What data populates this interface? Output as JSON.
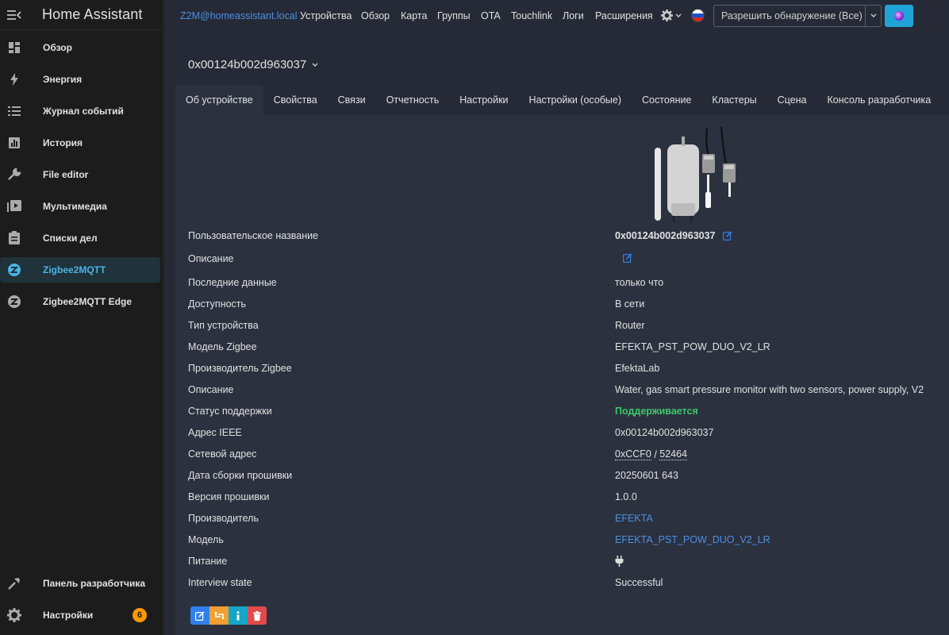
{
  "sidebar": {
    "title": "Home Assistant",
    "items": [
      {
        "label": "Обзор",
        "icon": "dashboard-icon"
      },
      {
        "label": "Энергия",
        "icon": "lightning-icon"
      },
      {
        "label": "Журнал событий",
        "icon": "list-icon"
      },
      {
        "label": "История",
        "icon": "chart-icon"
      },
      {
        "label": "File editor",
        "icon": "wrench-icon"
      },
      {
        "label": "Мультимедиа",
        "icon": "media-icon"
      },
      {
        "label": "Списки дел",
        "icon": "clipboard-icon"
      },
      {
        "label": "Zigbee2MQTT",
        "icon": "zigbee-icon"
      },
      {
        "label": "Zigbee2MQTT Edge",
        "icon": "zigbee-icon"
      }
    ],
    "bottom": [
      {
        "label": "Панель разработчика",
        "icon": "hammer-icon"
      },
      {
        "label": "Настройки",
        "icon": "gear-icon",
        "badge": "6"
      }
    ],
    "active_color": "#4bb4e6",
    "badge_color": "#ff9800"
  },
  "topnav": {
    "host": "Z2M@homeassistant.local",
    "links": [
      "Устройства",
      "Обзор",
      "Карта",
      "Группы",
      "OTA",
      "Touchlink",
      "Логи",
      "Расширения"
    ],
    "permit_join": "Разрешить обнаружение (Все)"
  },
  "device": {
    "title": "0x00124b002d963037",
    "tabs": [
      "Об устройстве",
      "Свойства",
      "Связи",
      "Отчетность",
      "Настройки",
      "Настройки (особые)",
      "Состояние",
      "Кластеры",
      "Сцена",
      "Консоль разработчика"
    ],
    "rows": [
      {
        "key": "Пользовательское название",
        "value": "0x00124b002d963037"
      },
      {
        "key": "Описание",
        "value": ""
      },
      {
        "key": "Последние данные",
        "value": "только что"
      },
      {
        "key": "Доступность",
        "value": "В сети"
      },
      {
        "key": "Тип устройства",
        "value": "Router"
      },
      {
        "key": "Модель Zigbee",
        "value": "EFEKTA_PST_POW_DUO_V2_LR"
      },
      {
        "key": "Производитель Zigbee",
        "value": "EfektaLab"
      },
      {
        "key": "Описание",
        "value": "Water, gas smart pressure monitor with two sensors, power supply, V2"
      },
      {
        "key": "Статус поддержки",
        "value": "Поддерживается"
      },
      {
        "key": "Адрес IEEE",
        "value": "0x00124b002d963037"
      },
      {
        "key": "Сетевой адрес",
        "value_hex": "0xCCF0",
        "value_sep": " / ",
        "value_dec": "52464"
      },
      {
        "key": "Дата сборки прошивки",
        "value": "20250601 643"
      },
      {
        "key": "Версия прошивки",
        "value": "1.0.0"
      },
      {
        "key": "Производитель",
        "value": "EFEKTA"
      },
      {
        "key": "Модель",
        "value": "EFEKTA_PST_POW_DUO_V2_LR"
      },
      {
        "key": "Питание",
        "value_icon": "plug-icon"
      },
      {
        "key": "Interview state",
        "value": "Successful"
      }
    ]
  },
  "colors": {
    "link": "#4a90e2",
    "supported": "#3cc86a",
    "panel_bg": "#2c3140",
    "main_bg": "#252a36"
  }
}
